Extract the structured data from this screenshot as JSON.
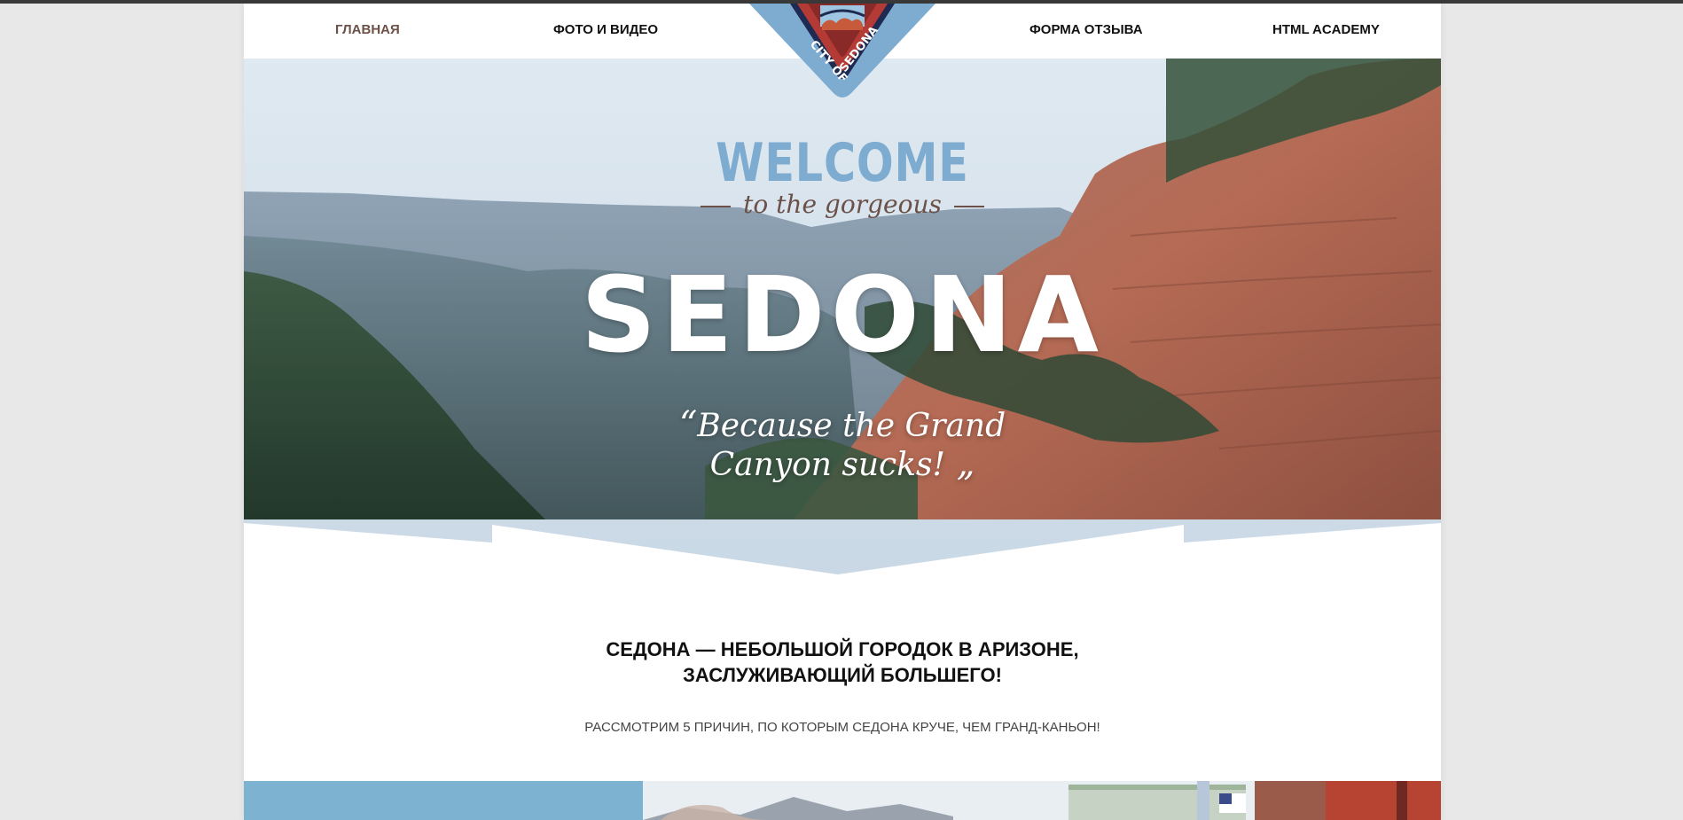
{
  "nav": {
    "items": [
      {
        "label": "Главная"
      },
      {
        "label": "Фото и видео"
      },
      {
        "label": "Форма отзыва"
      },
      {
        "label": "HTML Academy"
      }
    ]
  },
  "logo": {
    "text": "CITY OF SEDONA"
  },
  "hero": {
    "welcome": "WELCOME",
    "subtitle": "to the gorgeous",
    "title": "SEDONA",
    "quote_line1": "Because the Grand",
    "quote_line2": "Canyon sucks!"
  },
  "intro": {
    "heading_line1": "Седона — небольшой городок в Аризоне,",
    "heading_line2": "заслуживающий большего!",
    "subheading": "Рассмотрим 5 причин, по которым Седона круче, чем Гранд-Каньон!"
  },
  "colors": {
    "accent_blue": "#7eabd0",
    "brown": "#6b5148",
    "nav_active": "#6b5148"
  }
}
